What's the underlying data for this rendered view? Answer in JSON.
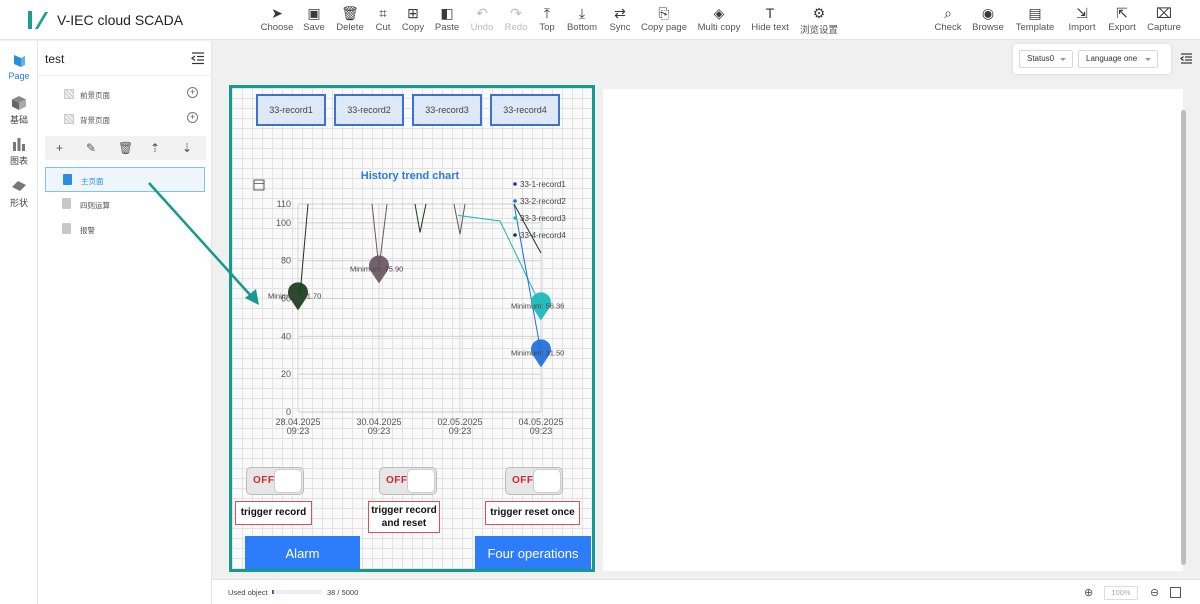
{
  "app": {
    "title": "V-IEC cloud SCADA",
    "brand_color": "#1b9d8f"
  },
  "toolbar": {
    "items": [
      {
        "label": "Choose",
        "icon": "cursor-icon",
        "glyph": "➤",
        "enabled": true
      },
      {
        "label": "Save",
        "icon": "save-icon",
        "glyph": "▣",
        "enabled": true
      },
      {
        "label": "Delete",
        "icon": "trash-icon",
        "glyph": "🗑",
        "enabled": true
      },
      {
        "label": "Cut",
        "icon": "crop-icon",
        "glyph": "⌗",
        "enabled": true
      },
      {
        "label": "Copy",
        "icon": "copy-icon",
        "glyph": "⊞",
        "enabled": true
      },
      {
        "label": "Paste",
        "icon": "paste-icon",
        "glyph": "◧",
        "enabled": true
      },
      {
        "label": "Undo",
        "icon": "undo-icon",
        "glyph": "↶",
        "enabled": false
      },
      {
        "label": "Redo",
        "icon": "redo-icon",
        "glyph": "↷",
        "enabled": false
      },
      {
        "label": "Top",
        "icon": "bring-top-icon",
        "glyph": "⤒",
        "enabled": true
      },
      {
        "label": "Bottom",
        "icon": "send-bottom-icon",
        "glyph": "⤓",
        "enabled": true
      },
      {
        "label": "Sync",
        "icon": "sync-icon",
        "glyph": "⇄",
        "enabled": true
      },
      {
        "label": "Copy page",
        "icon": "copy-page-icon",
        "glyph": "⎘",
        "enabled": true
      },
      {
        "label": "Multi copy",
        "icon": "layers-icon",
        "glyph": "◈",
        "enabled": true
      },
      {
        "label": "Hide text",
        "icon": "text-icon",
        "glyph": "T",
        "enabled": true
      },
      {
        "label": "浏览设置",
        "icon": "gear-icon",
        "glyph": "⚙",
        "enabled": true
      },
      {
        "label": "Check",
        "icon": "check-zoom-icon",
        "glyph": "⌕",
        "enabled": true
      },
      {
        "label": "Browse",
        "icon": "eye-icon",
        "glyph": "◉",
        "enabled": true
      },
      {
        "label": "Template",
        "icon": "template-icon",
        "glyph": "▤",
        "enabled": true
      },
      {
        "label": "Import",
        "icon": "import-icon",
        "glyph": "⇲",
        "enabled": true
      },
      {
        "label": "Export",
        "icon": "export-icon",
        "glyph": "⇱",
        "enabled": true
      },
      {
        "label": "Capture",
        "icon": "capture-icon",
        "glyph": "⌧",
        "enabled": true
      }
    ]
  },
  "leftnav": {
    "items": [
      {
        "label": "Page",
        "icon": "page-icon",
        "active": true
      },
      {
        "label": "基础",
        "icon": "cube-icon",
        "active": false
      },
      {
        "label": "图表",
        "icon": "bar-chart-icon",
        "active": false
      },
      {
        "label": "形状",
        "icon": "shape-icon",
        "active": false
      }
    ]
  },
  "page_panel": {
    "project_name": "test",
    "layers": [
      {
        "label": "前景页面"
      },
      {
        "label": "背景页面"
      }
    ],
    "pages": [
      {
        "label": "主页面",
        "selected": true
      },
      {
        "label": "四则运算",
        "selected": false
      },
      {
        "label": "报警",
        "selected": false
      }
    ]
  },
  "controls": {
    "status_select": "Status0",
    "language_select": "Language one"
  },
  "design": {
    "record_buttons": [
      "33-record1",
      "33-record2",
      "33-record3",
      "33-record4"
    ],
    "toggles": [
      {
        "state": "OFF",
        "label": "trigger record"
      },
      {
        "state": "OFF",
        "label": "trigger record and reset"
      },
      {
        "state": "OFF",
        "label": "trigger reset once"
      }
    ],
    "buttons": [
      "Alarm",
      "Four operations"
    ]
  },
  "chart_data": {
    "type": "line",
    "title": "History trend chart",
    "xlabel": "",
    "ylabel": "",
    "ylim": [
      0,
      110
    ],
    "yticks": [
      0,
      20,
      40,
      60,
      80,
      100,
      110
    ],
    "x_ticks": [
      "28.04.2025 09:23",
      "30.04.2025 09:23",
      "02.05.2025 09:23",
      "04.05.2025 09:23"
    ],
    "legend_position": "top-right",
    "grid": true,
    "series": [
      {
        "name": "33-1-record1",
        "color": "#1a3a8a"
      },
      {
        "name": "33-2-record2",
        "color": "#1e6fd9"
      },
      {
        "name": "33-3-record3",
        "color": "#16b8b8"
      },
      {
        "name": "33-4-record4",
        "color": "#1a3a1a"
      }
    ],
    "min_markers": [
      {
        "label": "Minimum: 61.70",
        "value": 61.7,
        "color": "#1a3a1a"
      },
      {
        "label": "Minimum: 75.90",
        "value": 75.9,
        "color": "#6a5560"
      },
      {
        "label": "Minimum: 56.36",
        "value": 56.36,
        "color": "#16b8b8"
      },
      {
        "label": "Minimum: 31.50",
        "value": 31.5,
        "color": "#1e6fd9"
      }
    ]
  },
  "bottombar": {
    "used_label": "Used object",
    "used_count": "38 / 5000",
    "used_fraction": 0.0076,
    "zoom": "100%"
  }
}
